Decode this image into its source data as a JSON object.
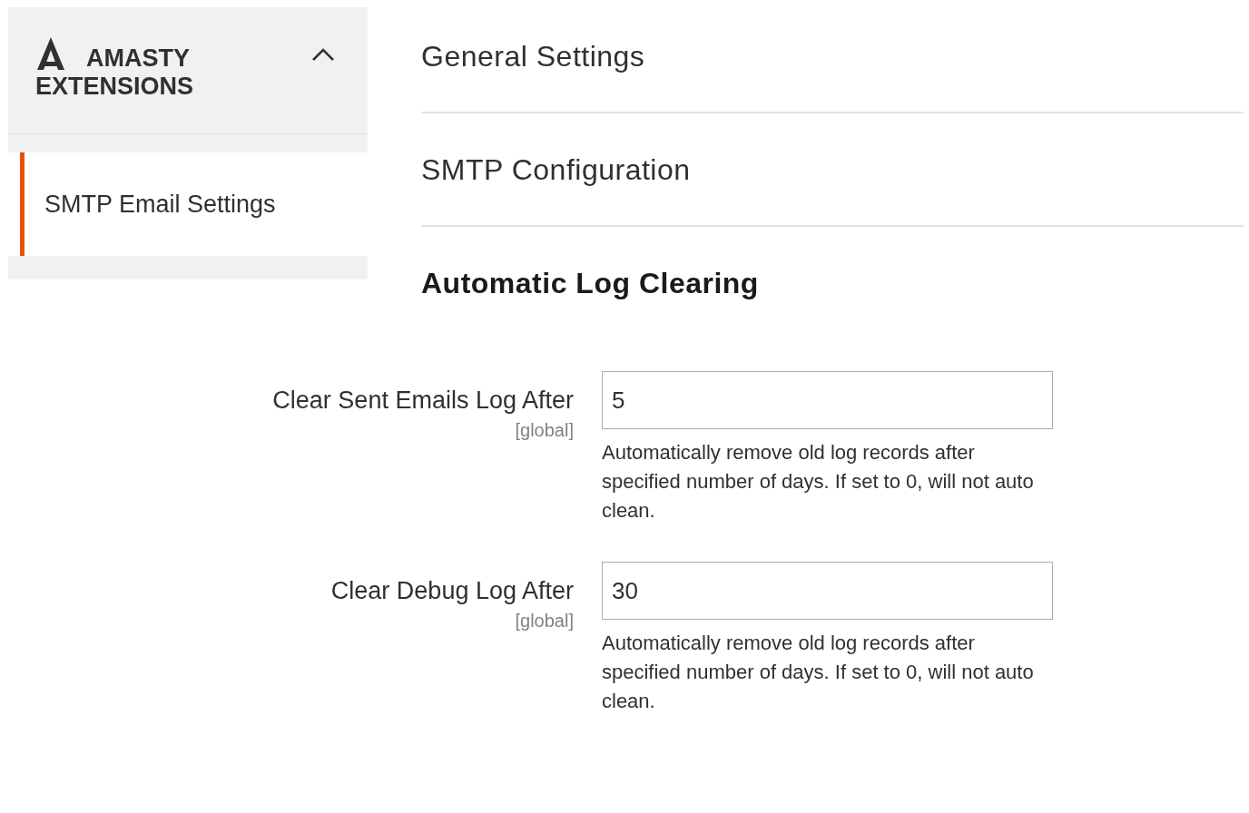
{
  "sidebar": {
    "group": {
      "title_line_1": "AMASTY",
      "title_line_2": "EXTENSIONS",
      "expanded": true
    },
    "items": [
      {
        "label": "SMTP Email Settings",
        "selected": true
      }
    ]
  },
  "sections": [
    {
      "title": "General Settings",
      "expanded": false
    },
    {
      "title": "SMTP Configuration",
      "expanded": false
    },
    {
      "title": "Automatic Log Clearing",
      "expanded": true,
      "fields": [
        {
          "label": "Clear Sent Emails Log After",
          "scope": "[global]",
          "value": "5",
          "note": "Automatically remove old log records after specified number of days. If set to 0, will not auto clean."
        },
        {
          "label": "Clear Debug Log After",
          "scope": "[global]",
          "value": "30",
          "note": "Automatically remove old log records after specified number of days. If set to 0, will not auto clean."
        }
      ]
    }
  ]
}
